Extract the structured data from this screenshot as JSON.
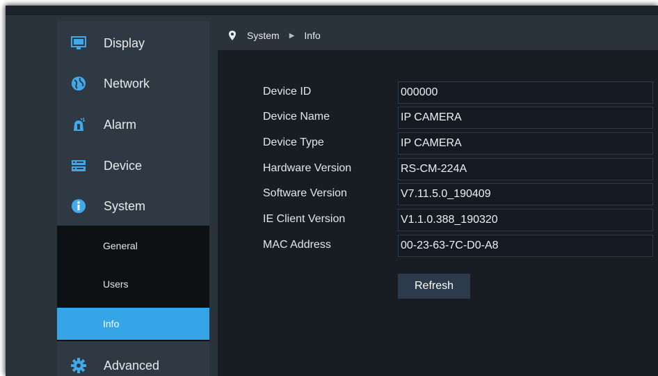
{
  "breadcrumb": {
    "section": "System",
    "page": "Info"
  },
  "sidebar": {
    "items": [
      {
        "label": "Display",
        "icon": "monitor-icon"
      },
      {
        "label": "Network",
        "icon": "globe-icon"
      },
      {
        "label": "Alarm",
        "icon": "alarm-icon"
      },
      {
        "label": "Device",
        "icon": "storage-icon"
      },
      {
        "label": "System",
        "icon": "info-icon"
      },
      {
        "label": "Advanced",
        "icon": "gear-icon"
      }
    ],
    "submenu": [
      {
        "label": "General"
      },
      {
        "label": "Users"
      },
      {
        "label": "Info",
        "active": true
      }
    ]
  },
  "info": {
    "rows": [
      {
        "label": "Device ID",
        "value": "000000"
      },
      {
        "label": "Device Name",
        "value": "IP CAMERA"
      },
      {
        "label": "Device Type",
        "value": "IP CAMERA"
      },
      {
        "label": "Hardware Version",
        "value": "RS-CM-224A"
      },
      {
        "label": "Software Version",
        "value": "V7.11.5.0_190409"
      },
      {
        "label": "IE Client Version",
        "value": "V1.1.0.388_190320"
      },
      {
        "label": "MAC Address",
        "value": "00-23-63-7C-D0-A8"
      }
    ],
    "refresh_label": "Refresh"
  },
  "colors": {
    "accent": "#36a5e8",
    "sidebar": "#2f3944",
    "panel": "#181d23"
  }
}
